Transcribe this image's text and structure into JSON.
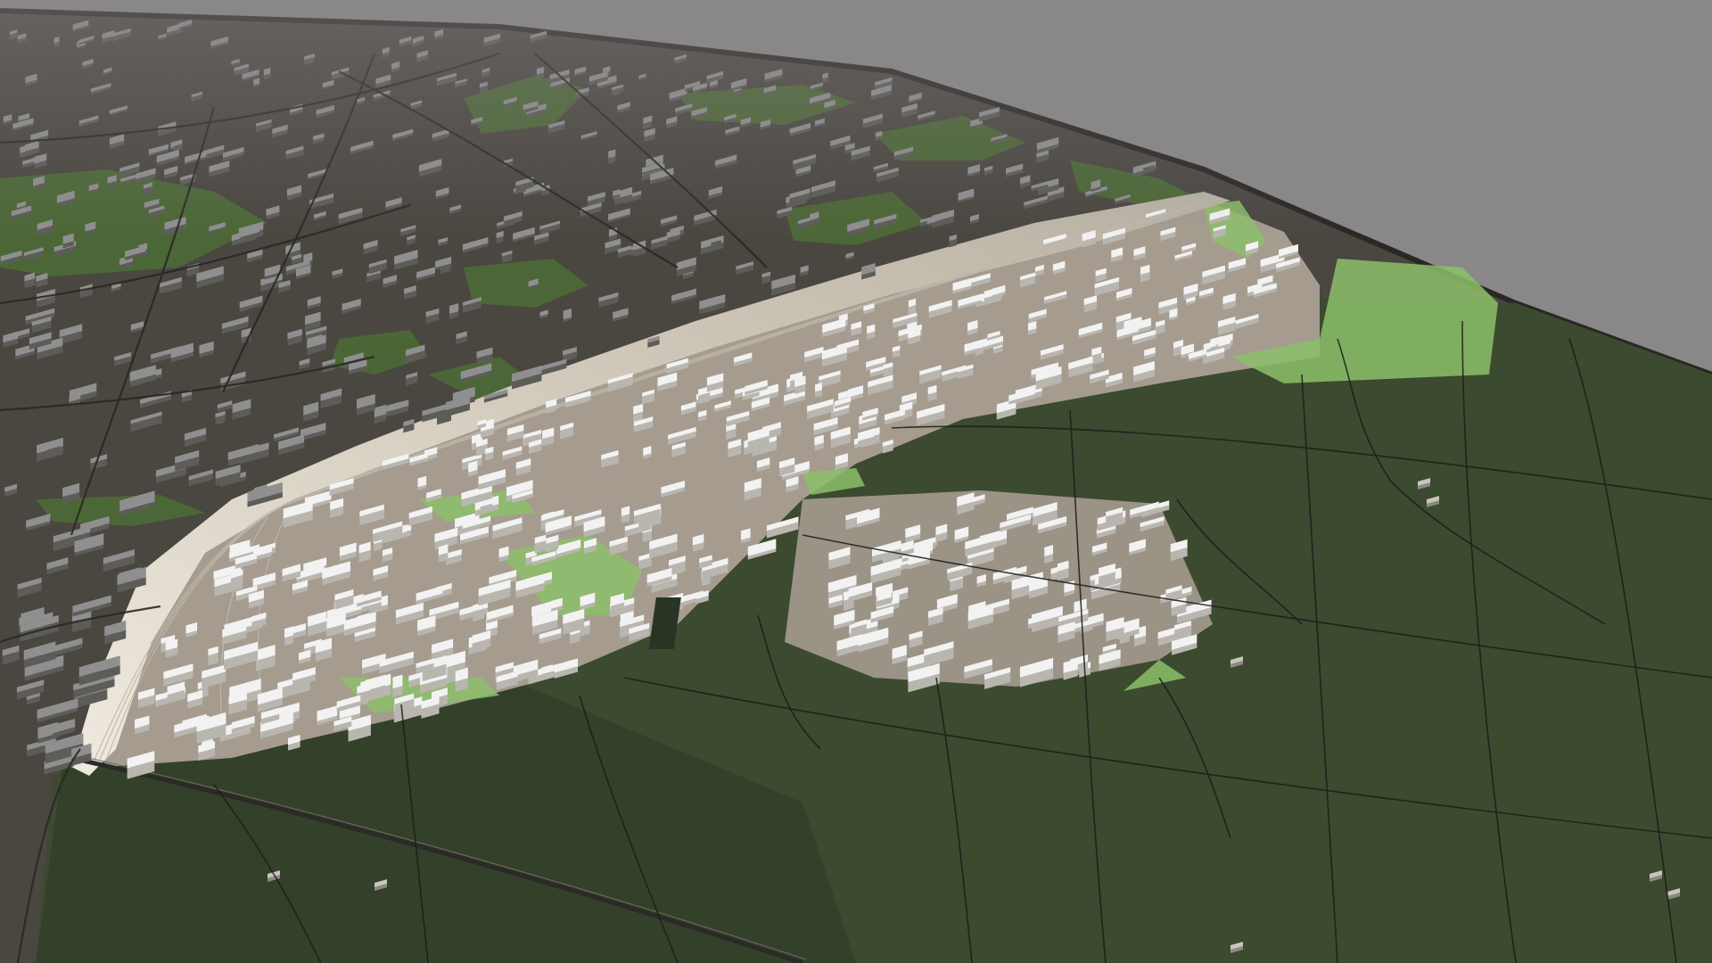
{
  "scene": {
    "kind": "3d-city-model-aerial-view",
    "colors": {
      "sky": "#8a8789",
      "urban_ground": "#4a4640",
      "urban_ground_light": "#5c564e",
      "forest": "#3c4a30",
      "forest_dark": "#33402a",
      "park_green": "#4c6a36",
      "highlight_green": "#8cc06a",
      "highlight_ground": "#a59c8f",
      "building_context": "#8f8f8f",
      "building_highlight": "#f2f2f2",
      "road": "#1c1c1a",
      "rail": "#d8d2c6",
      "map_edge": "#2a2824"
    },
    "layers": [
      "sky",
      "urban-context",
      "forest",
      "highlighted-district",
      "railway-corridor",
      "context-buildings",
      "highlighted-buildings",
      "road-network"
    ]
  }
}
